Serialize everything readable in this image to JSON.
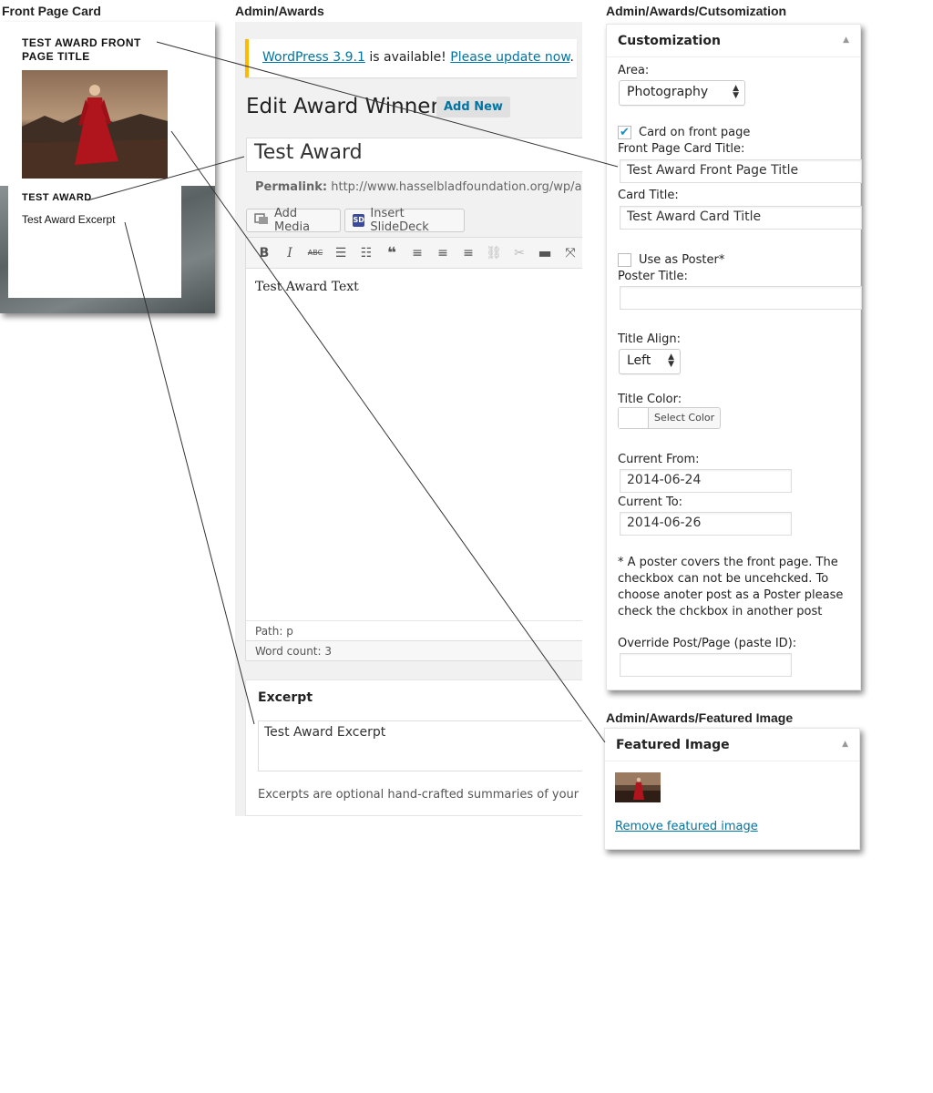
{
  "labels": {
    "front_page_card": "Front Page Card",
    "admin_awards": "Admin/Awards",
    "admin_customization": "Admin/Awards/Cutsomization",
    "admin_featured": "Admin/Awards/Featured Image"
  },
  "front_card": {
    "title": "TEST AWARD FRONT PAGE TITLE",
    "card_title": "TEST AWARD",
    "excerpt": "Test Award Excerpt"
  },
  "notice": {
    "version_link": "WordPress 3.9.1",
    "middle": " is available! ",
    "update_link": "Please update now",
    "end": "."
  },
  "editor": {
    "page_title": "Edit Award Winner",
    "add_new": "Add New",
    "title_value": "Test Award",
    "permalink_label": "Permalink:",
    "permalink_url": "http://www.hasselbladfoundation.org/wp/award",
    "add_media": "Add Media",
    "insert_slidedeck": "Insert SlideDeck",
    "slidedeck_badge": "SD",
    "toolbar_icons": [
      "bold-icon",
      "italic-icon",
      "strikethrough-icon",
      "bullet-list-icon",
      "numbered-list-icon",
      "blockquote-icon",
      "align-left-icon",
      "align-center-icon",
      "align-right-icon",
      "link-icon",
      "unlink-icon",
      "read-more-icon",
      "fullscreen-icon"
    ],
    "body_text": "Test Award Text",
    "path": "Path: p",
    "word_count": "Word count: 3"
  },
  "excerpt": {
    "heading": "Excerpt",
    "value": "Test Award Excerpt",
    "help": "Excerpts are optional hand-crafted summaries of your conte"
  },
  "customization": {
    "heading": "Customization",
    "area_label": "Area:",
    "area_value": "Photography",
    "card_on_front_label": "Card on front page",
    "card_on_front_checked": true,
    "front_title_label": "Front Page Card Title:",
    "front_title_value": "Test Award Front Page Title",
    "card_title_label": "Card Title:",
    "card_title_value": "Test Award Card Title",
    "use_poster_label": "Use as Poster*",
    "use_poster_checked": false,
    "poster_title_label": "Poster Title:",
    "poster_title_value": "",
    "title_align_label": "Title Align:",
    "title_align_value": "Left",
    "title_color_label": "Title Color:",
    "select_color": "Select Color",
    "current_from_label": "Current From:",
    "current_from_value": "2014-06-24",
    "current_to_label": "Current To:",
    "current_to_value": "2014-06-26",
    "note": "* A poster covers the front page. The checkbox can not be uncehcked. To choose anoter post as a Poster please check the chckbox in another post",
    "override_label": "Override Post/Page (paste ID):",
    "override_value": ""
  },
  "featured": {
    "heading": "Featured Image",
    "remove_link": "Remove featured image"
  },
  "colors": {
    "link": "#0074a2",
    "notice_border": "#ffba00",
    "checkbox_tick": "#1e8cbe",
    "dress_red": "#b0141c"
  }
}
